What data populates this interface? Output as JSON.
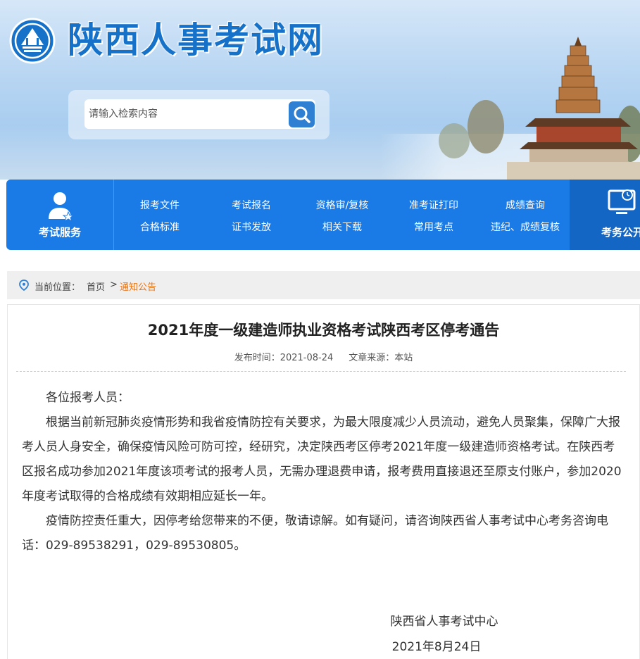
{
  "header": {
    "site_title": "陕西人事考试网",
    "search_placeholder": "请输入检索内容"
  },
  "nav": {
    "service_label": "考试服务",
    "links": [
      {
        "top": "报考文件",
        "bottom": "合格标准"
      },
      {
        "top": "考试报名",
        "bottom": "证书发放"
      },
      {
        "top": "资格审/复核",
        "bottom": "相关下载"
      },
      {
        "top": "准考证打印",
        "bottom": "常用考点"
      },
      {
        "top": "成绩查询",
        "bottom": "违纪、成绩复核"
      }
    ],
    "affairs_label": "考务公开"
  },
  "breadcrumb": {
    "prefix": "当前位置：",
    "home": "首页",
    "separator": ">",
    "current": "通知公告"
  },
  "article": {
    "title": "2021年度一级建造师执业资格考试陕西考区停考通告",
    "publish_time": "发布时间：2021-08-24",
    "source": "文章来源：本站",
    "paragraphs": [
      "各位报考人员：",
      "根据当前新冠肺炎疫情形势和我省疫情防控有关要求，为最大限度减少人员流动，避免人员聚集，保障广大报考人员人身安全，确保疫情风险可防可控，经研究，决定陕西考区停考2021年度一级建造师资格考试。在陕西考区报名成功参加2021年度该项考试的报考人员，无需办理退费申请，报考费用直接退还至原支付账户，参加2020年度考试取得的合格成绩有效期相应延长一年。",
      "疫情防控责任重大，因停考给您带来的不便，敬请谅解。如有疑问，请咨询陕西省人事考试中心考务咨询电话：029-89538291，029-89530805。"
    ],
    "signature": "陕西省人事考试中心",
    "date": "2021年8月24日"
  },
  "colors": {
    "brand_blue": "#1672c9",
    "nav_blue": "#1b7be6",
    "accent_orange": "#e8761a"
  }
}
